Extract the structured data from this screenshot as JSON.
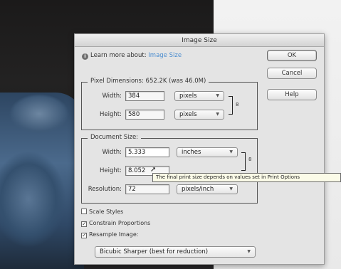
{
  "window": {
    "title": "Image Size"
  },
  "learn_more": {
    "prefix": "Learn more about:",
    "link": "Image Size"
  },
  "buttons": {
    "ok": "OK",
    "cancel": "Cancel",
    "help": "Help"
  },
  "pixel_dimensions": {
    "title": "Pixel Dimensions:  652.2K (was 46.0M)",
    "width": {
      "label": "Width:",
      "value": "384",
      "unit": "pixels"
    },
    "height": {
      "label": "Height:",
      "value": "580",
      "unit": "pixels"
    }
  },
  "document_size": {
    "title": "Document Size:",
    "width": {
      "label": "Width:",
      "value": "5.333",
      "unit": "inches"
    },
    "height": {
      "label": "Height:",
      "value": "8.052"
    },
    "resolution": {
      "label": "Resolution:",
      "value": "72",
      "unit": "pixels/inch"
    }
  },
  "tooltip": "The final print size depends on values set in Print Options",
  "options": {
    "scale_styles": {
      "label": "Scale Styles",
      "checked": false
    },
    "constrain_proportions": {
      "label": "Constrain Proportions",
      "checked": true
    },
    "resample_image": {
      "label": "Resample Image:",
      "checked": true
    }
  },
  "resample_method": "Bicubic Sharper (best for reduction)",
  "icons": {
    "info": "info-icon",
    "dropdown": "chevron-down-icon",
    "link": "chain-link-icon",
    "cursor": "pointer-cursor-icon"
  }
}
